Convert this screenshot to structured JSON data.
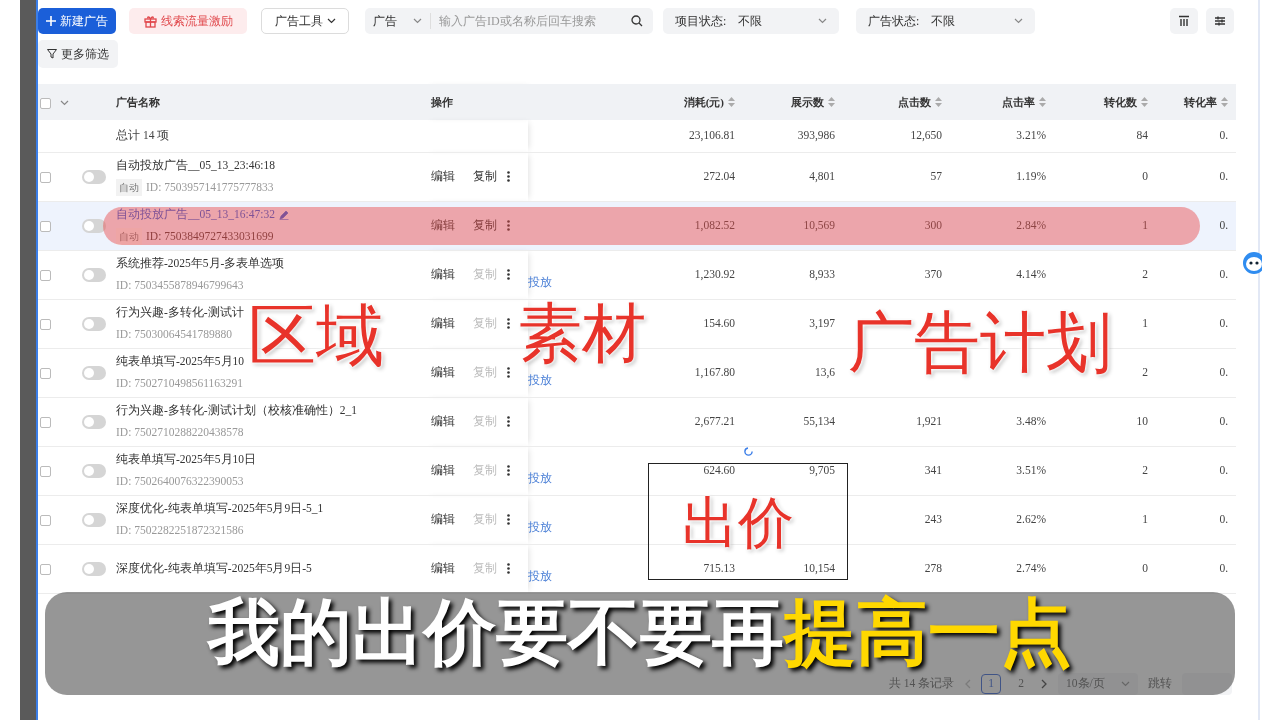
{
  "toolbar": {
    "new_button": "新建广告",
    "incentive_button": "线索流量激励",
    "tools_dropdown": "广告工具",
    "search": {
      "scope": "广告",
      "placeholder": "输入广告ID或名称后回车搜索"
    },
    "filters": [
      {
        "label": "项目状态:",
        "value": "不限"
      },
      {
        "label": "广告状态:",
        "value": "不限"
      }
    ],
    "more_filters": "更多筛选"
  },
  "table": {
    "select_all": {
      "checked": false
    },
    "columns": [
      {
        "label": "广告名称",
        "kind": "name"
      },
      {
        "label": "操作",
        "kind": "actions"
      },
      {
        "label": "消耗(元)",
        "kind": "metric"
      },
      {
        "label": "展示数",
        "kind": "metric"
      },
      {
        "label": "点击数",
        "kind": "metric"
      },
      {
        "label": "点击率",
        "kind": "metric"
      },
      {
        "label": "转化数",
        "kind": "metric"
      },
      {
        "label": "转化率",
        "kind": "metric"
      }
    ],
    "summary": {
      "label": "总计 14 项",
      "values": {
        "cost": "23,106.81",
        "impressions": "393,986",
        "clicks": "12,650",
        "ctr": "3.21%",
        "conversions": "84",
        "cvr": "0."
      }
    },
    "rows": [
      {
        "checked": false,
        "on": false,
        "selected": false,
        "name": "自动投放广告__05_13_23:46:18",
        "tag": "自动",
        "id": "ID: 7503957141775777833",
        "actions": [
          {
            "label": "编辑",
            "disabled": false
          },
          {
            "label": "复制",
            "disabled": false
          }
        ],
        "values": {
          "cost": "272.04",
          "impressions": "4,801",
          "clicks": "57",
          "ctr": "1.19%",
          "conversions": "0",
          "cvr": "0."
        }
      },
      {
        "checked": false,
        "on": false,
        "selected": true,
        "name": "自动投放广告__05_13_16:47:32",
        "tag": "自动",
        "id": "ID: 7503849727433031699",
        "actions": [
          {
            "label": "编辑",
            "disabled": false
          },
          {
            "label": "复制",
            "disabled": false
          }
        ],
        "values": {
          "cost": "1,082.52",
          "impressions": "10,569",
          "clicks": "300",
          "ctr": "2.84%",
          "conversions": "1",
          "cvr": "0."
        }
      },
      {
        "checked": false,
        "on": false,
        "selected": false,
        "name": "系统推荐-2025年5月-多表单选项",
        "id": "ID: 7503455878946799643",
        "actions": [
          {
            "label": "编辑",
            "disabled": false
          },
          {
            "label": "复制",
            "disabled": true
          }
        ],
        "deploy_link": "投放",
        "values": {
          "cost": "1,230.92",
          "impressions": "8,933",
          "clicks": "370",
          "ctr": "4.14%",
          "conversions": "2",
          "cvr": "0."
        }
      },
      {
        "checked": false,
        "on": false,
        "selected": false,
        "name": "行为兴趣-多转化-测试计",
        "id": "ID: 75030064541789880",
        "actions": [
          {
            "label": "编辑",
            "disabled": false
          },
          {
            "label": "复制",
            "disabled": true
          }
        ],
        "values": {
          "cost": "154.60",
          "impressions": "3,197",
          "conversions": "1",
          "cvr": "0."
        }
      },
      {
        "checked": false,
        "on": false,
        "selected": false,
        "name": "纯表单填写-2025年5月10",
        "id": "ID: 7502710498561163291",
        "actions": [
          {
            "label": "编辑",
            "disabled": false
          },
          {
            "label": "复制",
            "disabled": true
          }
        ],
        "deploy_link": "投放",
        "values": {
          "cost": "1,167.80",
          "impressions": "13,6",
          "conversions": "2",
          "cvr": "0."
        }
      },
      {
        "checked": false,
        "on": false,
        "selected": false,
        "name": "行为兴趣-多转化-测试计划（校核准确性）2_1",
        "id": "ID: 7502710288220438578",
        "actions": [
          {
            "label": "编辑",
            "disabled": false
          },
          {
            "label": "复制",
            "disabled": true
          }
        ],
        "values": {
          "cost": "2,677.21",
          "impressions": "55,134",
          "clicks": "1,921",
          "ctr": "3.48%",
          "conversions": "10",
          "cvr": "0."
        }
      },
      {
        "checked": false,
        "on": false,
        "selected": false,
        "name": "纯表单填写-2025年5月10日",
        "id": "ID: 7502640076322390053",
        "actions": [
          {
            "label": "编辑",
            "disabled": false
          },
          {
            "label": "复制",
            "disabled": true
          }
        ],
        "deploy_link": "投放",
        "values": {
          "cost": "624.60",
          "impressions": "9,705",
          "clicks": "341",
          "ctr": "3.51%",
          "conversions": "2",
          "cvr": "0."
        }
      },
      {
        "checked": false,
        "on": false,
        "selected": false,
        "name": "深度优化-纯表单填写-2025年5月9日-5_1",
        "id": "ID: 7502282251872321586",
        "actions": [
          {
            "label": "编辑",
            "disabled": false
          },
          {
            "label": "复制",
            "disabled": true
          }
        ],
        "deploy_link": "投放",
        "values": {
          "clicks": "243",
          "ctr": "2.62%",
          "conversions": "1",
          "cvr": "0."
        }
      },
      {
        "checked": false,
        "on": false,
        "selected": false,
        "name": "深度优化-纯表单填写-2025年5月9日-5",
        "actions": [
          {
            "label": "编辑",
            "disabled": false
          },
          {
            "label": "复制",
            "disabled": true
          }
        ],
        "deploy_link": "投放",
        "values": {
          "cost": "715.13",
          "impressions": "10,154",
          "clicks": "278",
          "ctr": "2.74%",
          "conversions": "0",
          "cvr": "0."
        }
      }
    ]
  },
  "pagination": {
    "total": "共 14 条记录",
    "pages": [
      {
        "label": "1",
        "selected": true
      },
      {
        "label": "2",
        "selected": false
      }
    ],
    "page_size": "10条/页",
    "jump": "跳转"
  },
  "annotations": [
    {
      "text": "区域"
    },
    {
      "text": "素材"
    },
    {
      "text": "广告计划"
    },
    {
      "text": "出价"
    }
  ],
  "caption": {
    "segments": [
      {
        "text": "我的出价要不要再",
        "kind": "plain"
      },
      {
        "text": "提高一点",
        "kind": "emphasis"
      }
    ]
  }
}
